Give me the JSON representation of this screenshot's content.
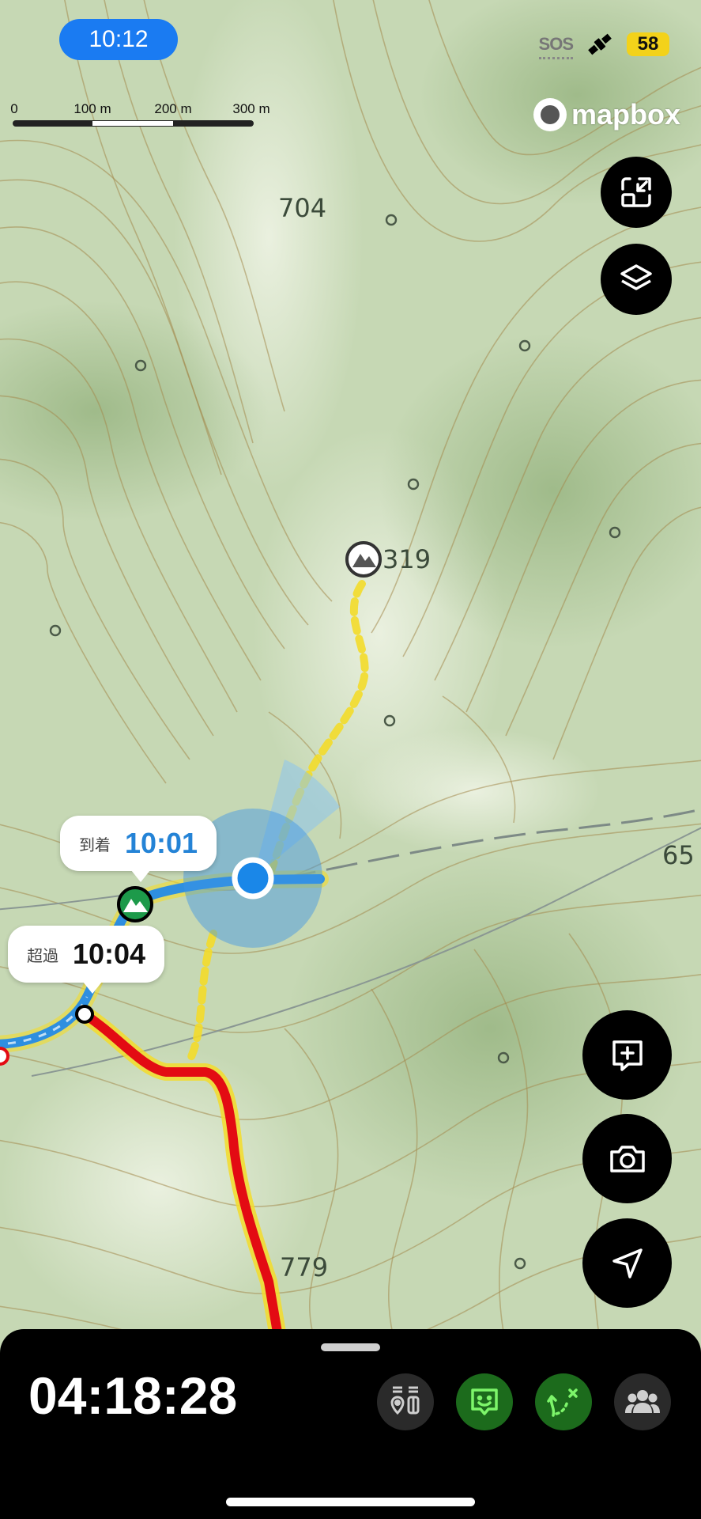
{
  "status_bar": {
    "time": "10:12",
    "sos_label": "SOS",
    "battery": "58"
  },
  "scale": {
    "labels": [
      "0",
      "100 m",
      "200 m",
      "300 m"
    ]
  },
  "attribution": {
    "brand": "mapbox"
  },
  "map": {
    "elevations": [
      "704",
      "319",
      "65",
      "779"
    ],
    "route_colors": {
      "planned": "#e30b13",
      "track": "#2e8fe0",
      "trail": "#f3dc2a",
      "location": "#1a87e8"
    }
  },
  "bubbles": {
    "arrival": {
      "label": "到着",
      "time": "10:01"
    },
    "overdue": {
      "label": "超過",
      "time": "10:04"
    }
  },
  "controls": {
    "top": [
      "compress-icon",
      "layers-icon"
    ],
    "floating": [
      "add-comment-icon",
      "camera-icon",
      "navigate-icon"
    ]
  },
  "bottom_sheet": {
    "elapsed": "04:18:28",
    "buttons": [
      "checkpoint-icon",
      "status-message-icon",
      "route-off-icon",
      "group-icon"
    ],
    "active_color": "#1c6b1c"
  }
}
